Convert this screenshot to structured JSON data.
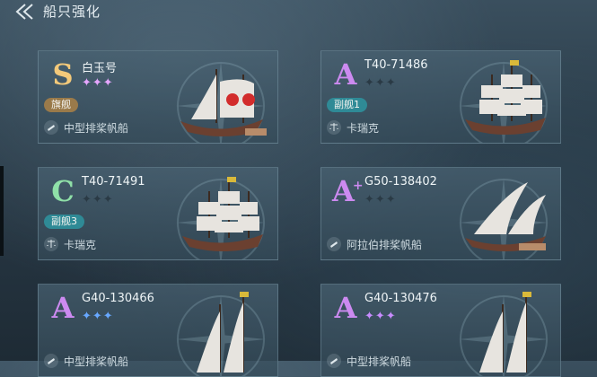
{
  "header": {
    "title": "船只强化",
    "back_icon": "back-arrow-icon"
  },
  "colors": {
    "badge_gold": "#9a7a4a",
    "badge_teal": "#2f8a96",
    "grade_S": "#f3c97a",
    "grade_A": "#cc8af0",
    "grade_C": "#8fe0a8"
  },
  "cards": [
    {
      "grade": "S",
      "grade_plus": "",
      "name": "白玉号",
      "stars": "✦✦✦",
      "badge": "旗舰",
      "type": "中型排桨帆船",
      "type_icon": "horn-icon"
    },
    {
      "grade": "A",
      "grade_plus": "",
      "name": "T40-71486",
      "stars": "✦✦✦",
      "badge": "副舰1",
      "type": "卡瑞克",
      "type_icon": "scale-icon"
    },
    {
      "grade": "C",
      "grade_plus": "",
      "name": "T40-71491",
      "stars": "✦✦✦",
      "badge": "副舰3",
      "type": "卡瑞克",
      "type_icon": "scale-icon"
    },
    {
      "grade": "A",
      "grade_plus": "+",
      "name": "G50-138402",
      "stars": "✦✦✦",
      "badge": "",
      "type": "阿拉伯排桨帆船",
      "type_icon": "horn-icon"
    },
    {
      "grade": "A",
      "grade_plus": "",
      "name": "G40-130466",
      "stars": "✦✦✦",
      "badge": "",
      "type": "中型排桨帆船",
      "type_icon": "horn-icon"
    },
    {
      "grade": "A",
      "grade_plus": "",
      "name": "G40-130476",
      "stars": "✦✦✦",
      "badge": "",
      "type": "中型排桨帆船",
      "type_icon": "horn-icon"
    }
  ]
}
